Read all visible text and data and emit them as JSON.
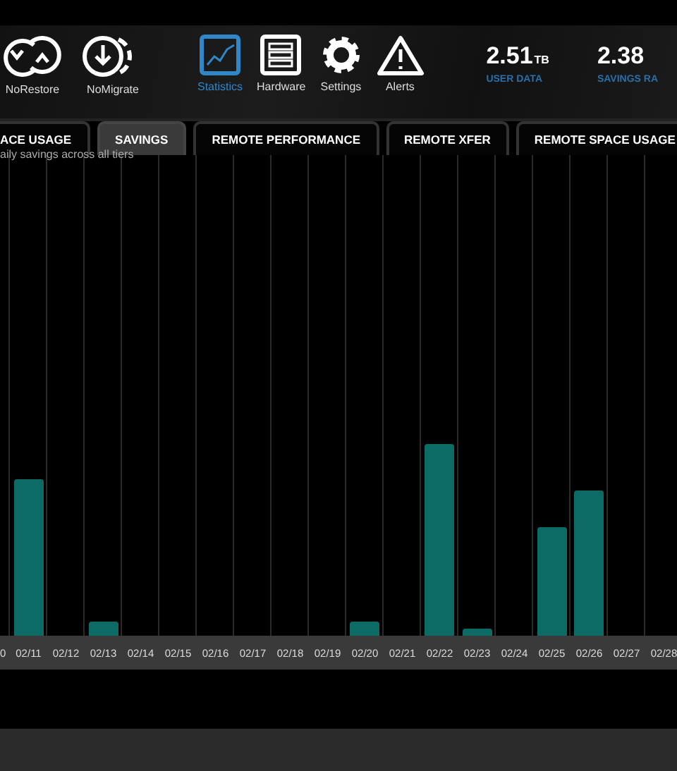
{
  "toolbar": {
    "items": [
      {
        "label": "NoRestore",
        "kind": "norestore",
        "selected": false
      },
      {
        "label": "NoMigrate",
        "kind": "nomigrate",
        "selected": false
      },
      {
        "label": "Statistics",
        "kind": "statistics",
        "selected": true
      },
      {
        "label": "Hardware",
        "kind": "hardware",
        "selected": false
      },
      {
        "label": "Settings",
        "kind": "settings",
        "selected": false
      },
      {
        "label": "Alerts",
        "kind": "alerts",
        "selected": false
      }
    ]
  },
  "stats": [
    {
      "value": "2.51",
      "unit": "TB",
      "label": "USER DATA"
    },
    {
      "value": "2.38",
      "label": "SAVINGS RA"
    }
  ],
  "tabs": [
    {
      "label": "ACE USAGE",
      "selected": false
    },
    {
      "label": "SAVINGS",
      "selected": true
    },
    {
      "label": "REMOTE PERFORMANCE",
      "selected": false
    },
    {
      "label": "REMOTE XFER",
      "selected": false
    },
    {
      "label": "REMOTE SPACE USAGE",
      "selected": false
    }
  ],
  "subtitle": "aily savings across all tiers",
  "chart": {
    "x_labels": [
      "0",
      "02/11",
      "02/12",
      "02/13",
      "02/14",
      "02/15",
      "02/16",
      "02/17",
      "02/18",
      "02/19",
      "02/20",
      "02/21",
      "02/22",
      "02/23",
      "02/24",
      "02/25",
      "02/26",
      "02/27",
      "02/28"
    ]
  }
}
